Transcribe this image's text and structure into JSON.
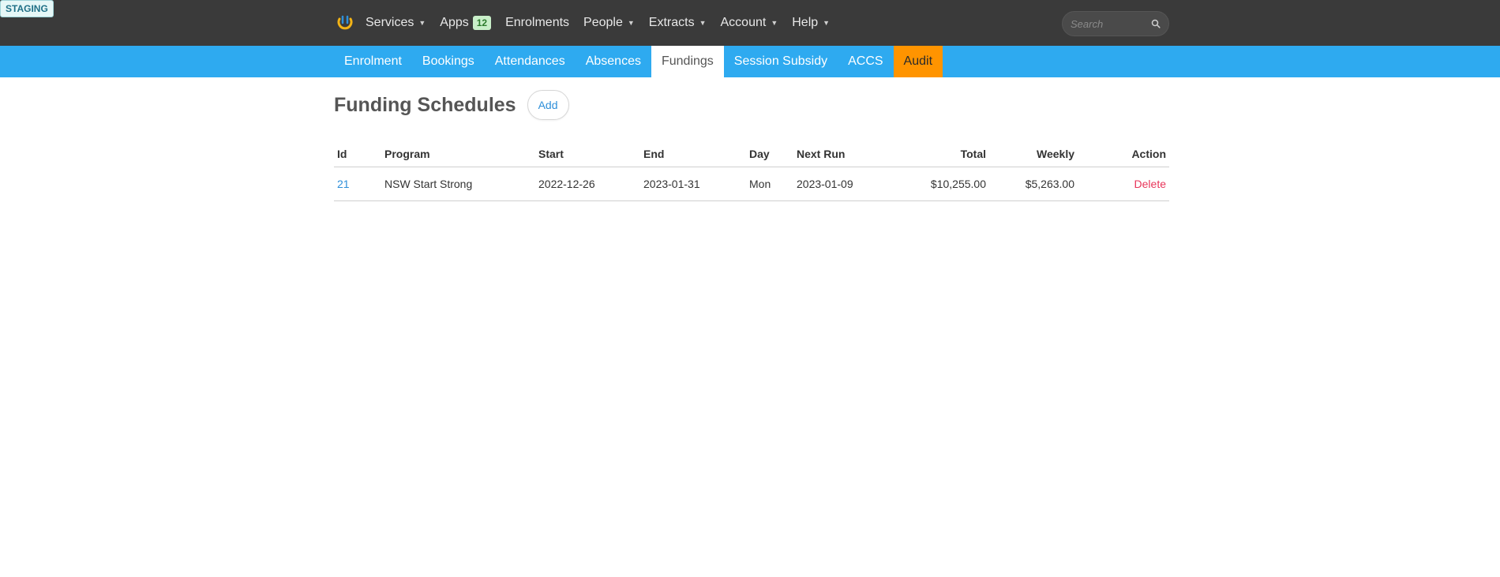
{
  "environment_badge": "STAGING",
  "topnav": {
    "items": [
      {
        "label": "Services",
        "caret": true
      },
      {
        "label": "Apps",
        "badge": "12",
        "caret": false
      },
      {
        "label": "Enrolments",
        "caret": false
      },
      {
        "label": "People",
        "caret": true
      },
      {
        "label": "Extracts",
        "caret": true
      },
      {
        "label": "Account",
        "caret": true
      },
      {
        "label": "Help",
        "caret": true
      }
    ],
    "caret_glyph": "▼",
    "search_placeholder": "Search"
  },
  "subnav": {
    "tabs": [
      {
        "label": "Enrolment"
      },
      {
        "label": "Bookings"
      },
      {
        "label": "Attendances"
      },
      {
        "label": "Absences"
      },
      {
        "label": "Fundings",
        "active": true
      },
      {
        "label": "Session Subsidy"
      },
      {
        "label": "ACCS"
      },
      {
        "label": "Audit",
        "highlight": "#ff9400"
      }
    ]
  },
  "main": {
    "title": "Funding Schedules",
    "add_label": "Add",
    "table": {
      "columns": [
        "Id",
        "Program",
        "Start",
        "End",
        "Day",
        "Next Run",
        "Total",
        "Weekly",
        "Action"
      ],
      "rows": [
        {
          "id": "21",
          "program": "NSW Start Strong",
          "start": "2022-12-26",
          "end": "2023-01-31",
          "day": "Mon",
          "next_run": "2023-01-09",
          "total": "$10,255.00",
          "weekly": "$5,263.00",
          "action": "Delete"
        }
      ]
    }
  },
  "colors": {
    "topbar": "#3a3a3a",
    "subnav": "#2eaaf0",
    "audit_tab": "#ff9400",
    "link": "#2e8fd9",
    "delete": "#e8365a"
  }
}
